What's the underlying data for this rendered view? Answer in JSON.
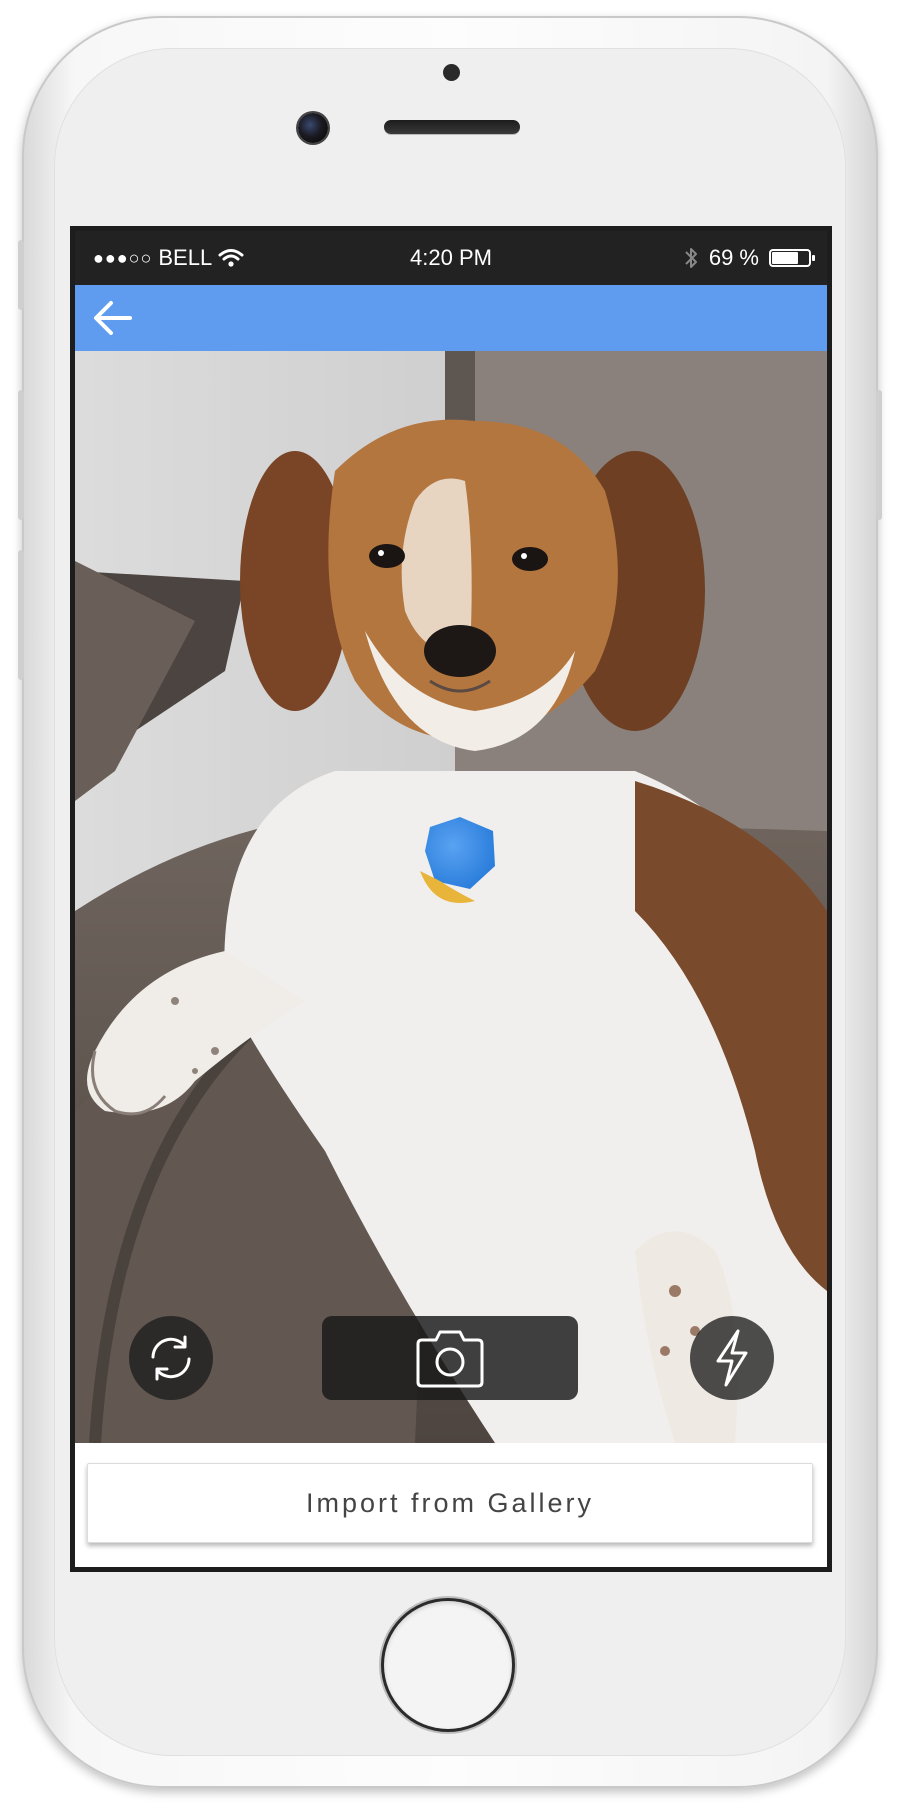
{
  "status_bar": {
    "signal": "●●●○○",
    "carrier": "BELL",
    "time": "4:20 PM",
    "battery_percent": "69 %",
    "battery_level": 0.69
  },
  "app_bar": {
    "back_icon": "arrow-left-icon",
    "color": "#5f9cf0"
  },
  "camera": {
    "switch_icon": "refresh-icon",
    "capture_icon": "camera-icon",
    "flash_icon": "lightning-icon"
  },
  "gallery": {
    "import_label": "Import from Gallery"
  }
}
